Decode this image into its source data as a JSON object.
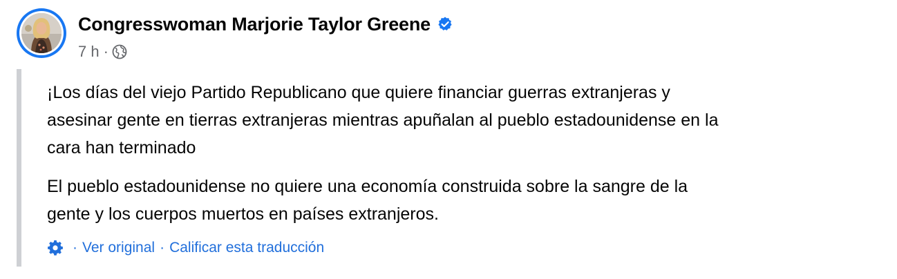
{
  "post": {
    "author": "Congresswoman Marjorie Taylor Greene",
    "timestamp": "7 h",
    "meta_separator": "·",
    "audience_icon": "globe-icon",
    "verified_icon": "verified-badge-icon",
    "verified_color": "#1877f2"
  },
  "translation": {
    "paragraph_1_lines": [
      "¡Los días del viejo Partido Republicano que quiere financiar guerras extranjeras y",
      "asesinar gente en tierras extranjeras mientras apuñalan al pueblo estadounidense en la",
      "cara han terminado"
    ],
    "paragraph_2_lines": [
      "El pueblo estadounidense no quiere una economía construida sobre la sangre de la",
      "gente y los cuerpos muertos en países extranjeros."
    ],
    "settings_icon": "gear-icon",
    "separator": "·",
    "see_original_label": "Ver original",
    "rate_translation_label": "Calificar esta traducción",
    "link_color": "#216fdb"
  }
}
